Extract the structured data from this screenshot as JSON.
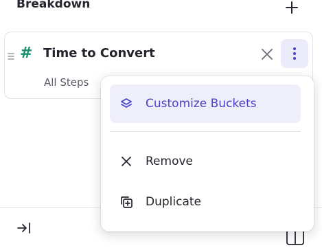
{
  "breakdown": {
    "title": "Breakdown"
  },
  "property": {
    "name": "Time to Convert",
    "scope": "All Steps",
    "type_icon": "hash-icon"
  },
  "menu": {
    "items": [
      {
        "label": "Customize Buckets",
        "icon": "layers-icon",
        "active": true
      },
      {
        "label": "Remove",
        "icon": "close-icon",
        "active": false
      },
      {
        "label": "Duplicate",
        "icon": "duplicate-icon",
        "active": false
      }
    ]
  },
  "colors": {
    "accent": "#4a43c4",
    "accent_bg": "#efeefb",
    "numeric_green": "#1a8f6e"
  }
}
